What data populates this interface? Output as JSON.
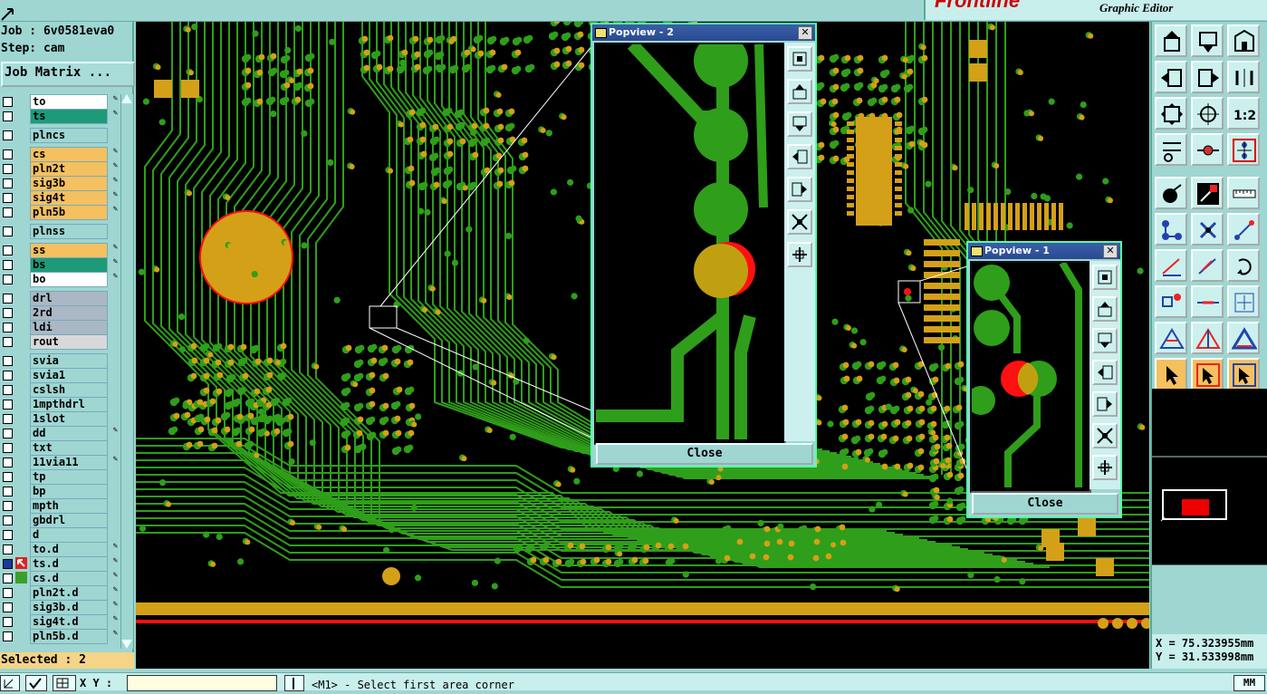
{
  "app": {
    "brand_logo": "Frontline",
    "brand_subtitle": "Graphic Editor"
  },
  "job": {
    "job_label": "Job : 6v0581eva0",
    "step_label": "Step: cam",
    "job_matrix_button": "Job Matrix ..."
  },
  "layers": [
    {
      "name": "to",
      "color": "#ffffff",
      "editable": true
    },
    {
      "name": "ts",
      "color": "#1f9a78",
      "editable": true
    },
    {
      "name": "plncs",
      "color": "#9fd6d2",
      "editable": false
    },
    {
      "name": "cs",
      "color": "#f4c060",
      "editable": true
    },
    {
      "name": "pln2t",
      "color": "#f4c060",
      "editable": true
    },
    {
      "name": "sig3b",
      "color": "#f4c060",
      "editable": true
    },
    {
      "name": "sig4t",
      "color": "#f4c060",
      "editable": true
    },
    {
      "name": "pln5b",
      "color": "#f4c060",
      "editable": true
    },
    {
      "name": "plnss",
      "color": "#9fd6d2",
      "editable": false
    },
    {
      "name": "ss",
      "color": "#f4c060",
      "editable": true
    },
    {
      "name": "bs",
      "color": "#1f9a78",
      "editable": true
    },
    {
      "name": "bo",
      "color": "#ffffff",
      "editable": true
    },
    {
      "name": "drl",
      "color": "#a9b8c4",
      "editable": false
    },
    {
      "name": "2rd",
      "color": "#a9b8c4",
      "editable": false
    },
    {
      "name": "ldi",
      "color": "#a9b8c4",
      "editable": false
    },
    {
      "name": "rout",
      "color": "#d8d8d8",
      "editable": false
    },
    {
      "name": "svia",
      "color": "#9fd6d2",
      "editable": false
    },
    {
      "name": "svia1",
      "color": "#9fd6d2",
      "editable": false
    },
    {
      "name": "cslsh",
      "color": "#9fd6d2",
      "editable": false
    },
    {
      "name": "1mpthdrl",
      "color": "#9fd6d2",
      "editable": false
    },
    {
      "name": "1slot",
      "color": "#9fd6d2",
      "editable": false
    },
    {
      "name": "dd",
      "color": "#9fd6d2",
      "editable": true
    },
    {
      "name": "txt",
      "color": "#9fd6d2",
      "editable": false
    },
    {
      "name": "11via11",
      "color": "#9fd6d2",
      "editable": true
    },
    {
      "name": "tp",
      "color": "#9fd6d2",
      "editable": false
    },
    {
      "name": "bp",
      "color": "#9fd6d2",
      "editable": false
    },
    {
      "name": "mpth",
      "color": "#9fd6d2",
      "editable": false
    },
    {
      "name": "gbdrl",
      "color": "#9fd6d2",
      "editable": false
    },
    {
      "name": "d",
      "color": "#9fd6d2",
      "editable": false
    },
    {
      "name": "to.d",
      "color": "#9fd6d2",
      "editable": true
    },
    {
      "name": "ts.d",
      "color": "#9fd6d2",
      "editable": true,
      "active": true
    },
    {
      "name": "cs.d",
      "color": "#9fd6d2",
      "editable": true,
      "swatch": "#3aa02a"
    },
    {
      "name": "pln2t.d",
      "color": "#9fd6d2",
      "editable": true
    },
    {
      "name": "sig3b.d",
      "color": "#9fd6d2",
      "editable": true
    },
    {
      "name": "sig4t.d",
      "color": "#9fd6d2",
      "editable": true
    },
    {
      "name": "pln5b.d",
      "color": "#9fd6d2",
      "editable": true
    }
  ],
  "selection": {
    "label": "Selected : 2"
  },
  "popup2": {
    "title": "Popview - 2",
    "close_label": "Close"
  },
  "popup1": {
    "title": "Popview - 1",
    "close_label": "Close"
  },
  "coords": {
    "x_label": "X = 75.323955mm",
    "y_label": "Y = 31.533998mm"
  },
  "status": {
    "units_button": "MM",
    "xy_label": "X Y :",
    "message": "<M1> - Select first area corner"
  },
  "colors": {
    "copper_trace": "#2f9e1a",
    "pad": "#d4a017",
    "highlight": "#ff1010",
    "board_bg": "#000000"
  },
  "toolbar_icons": [
    "zoom-home-icon",
    "zoom-in-icon",
    "zoom-out-icon",
    "pan-left-icon",
    "pan-right-icon",
    "zoom-ratio-icon",
    "fit-screen-icon",
    "center-icon",
    "one-to-two-icon",
    "measure-tool-icon",
    "probe-icon",
    "net-icon",
    "pad-feature-icon",
    "edit-feature-icon",
    "ruler-icon",
    "connect-icon",
    "delete-icon",
    "move-icon",
    "line-icon",
    "draw-line-icon",
    "undo-arc-icon",
    "split-icon",
    "cut-icon",
    "stretch-icon",
    "triangle-icon",
    "triangle-red-icon",
    "triangle-blue-icon",
    "select-pointer-icon",
    "select-red-icon",
    "select-region-icon"
  ]
}
